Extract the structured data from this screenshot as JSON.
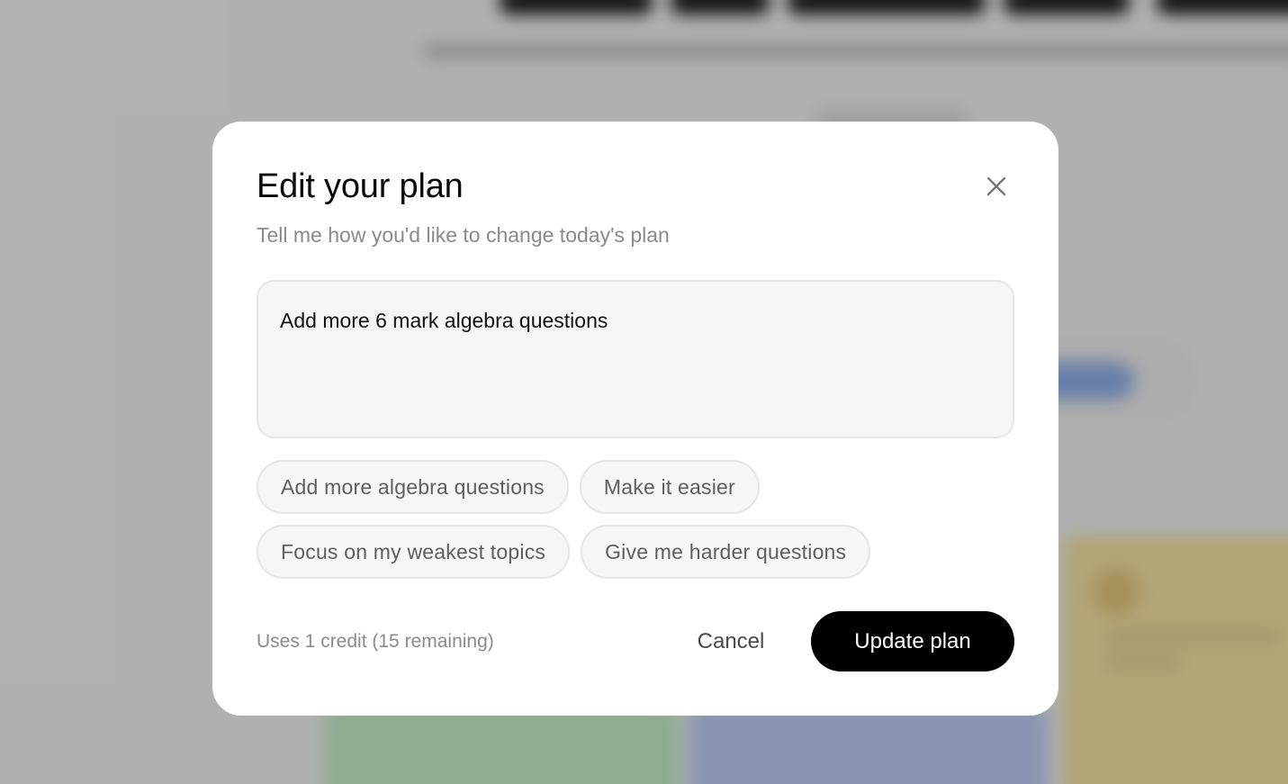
{
  "modal": {
    "title": "Edit your plan",
    "subtitle": "Tell me how you'd like to change today's plan",
    "close_icon": "close-icon",
    "request_text": "Add more 6 mark algebra questions",
    "suggestions": [
      [
        "Add more algebra questions",
        "Make it easier"
      ],
      [
        "Focus on my weakest topics",
        "Give me harder questions"
      ]
    ],
    "credit_note": "Uses 1 credit (15 remaining)",
    "cancel_label": "Cancel",
    "submit_label": "Update plan"
  },
  "colors": {
    "primary_button_bg": "#000000",
    "primary_button_text": "#ffffff",
    "chip_bg": "#f5f7f6",
    "chip_border": "#e3e6e4",
    "muted_text": "#8a8a8a"
  }
}
